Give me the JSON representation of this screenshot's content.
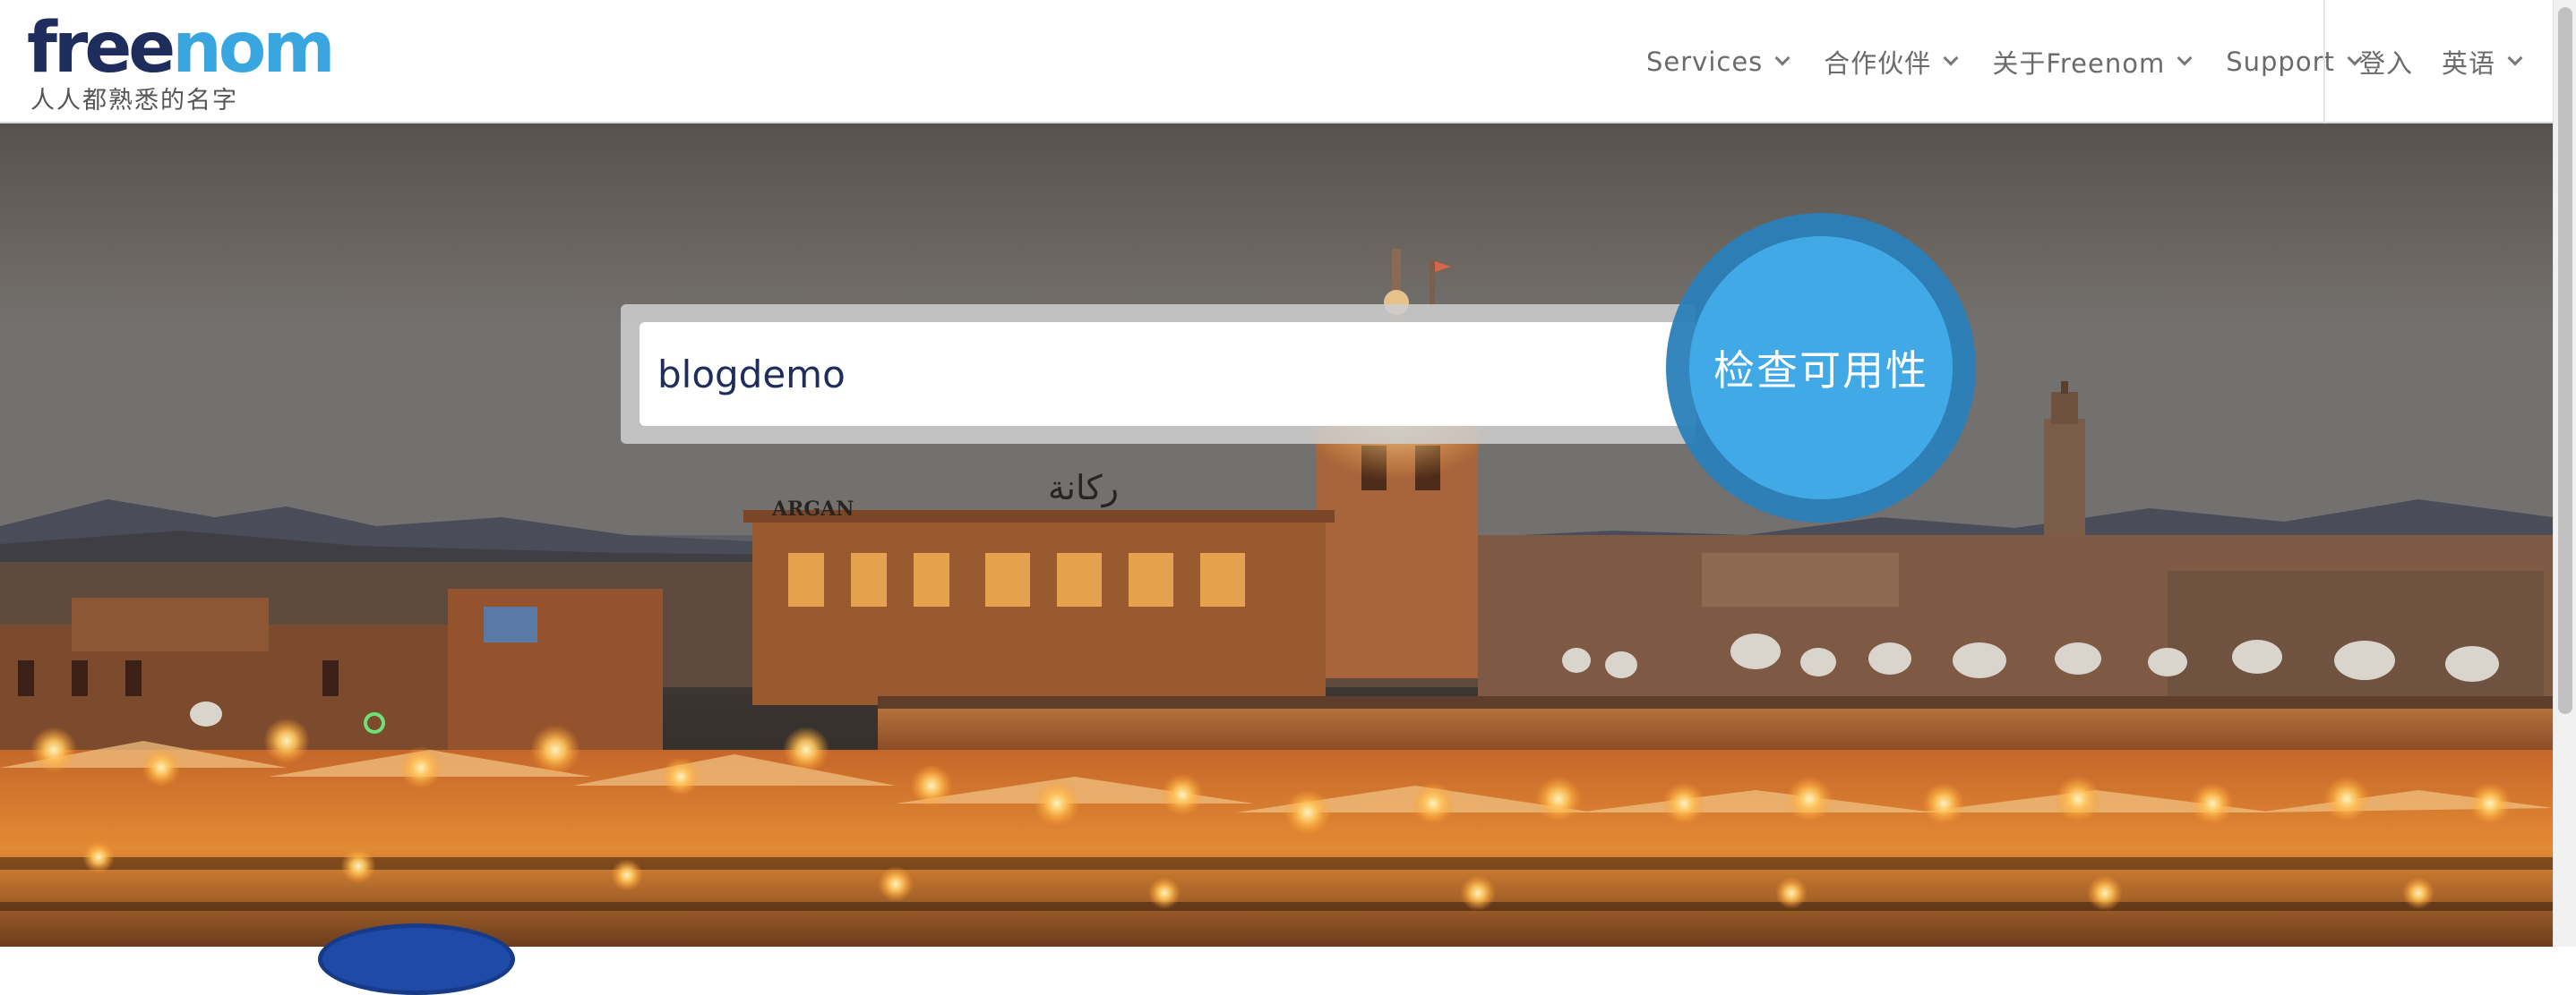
{
  "brand": {
    "logo_part1": "free",
    "logo_part2": "nom",
    "tagline": "人人都熟悉的名字"
  },
  "nav": {
    "items": [
      {
        "label": "Services"
      },
      {
        "label": "合作伙伴"
      },
      {
        "label": "关于Freenom"
      },
      {
        "label": "Support"
      }
    ],
    "login": "登入",
    "language": "英语"
  },
  "search": {
    "value": "blogdemo",
    "button_label": "检查可用性"
  },
  "hero_signs": {
    "argan": "ARGAN",
    "arabic": "ركانة"
  },
  "colors": {
    "brand_dark": "#1f2d5c",
    "brand_light": "#3aa6e0",
    "button_ring": "#2a80b9",
    "button_fill": "#41a9e6"
  }
}
